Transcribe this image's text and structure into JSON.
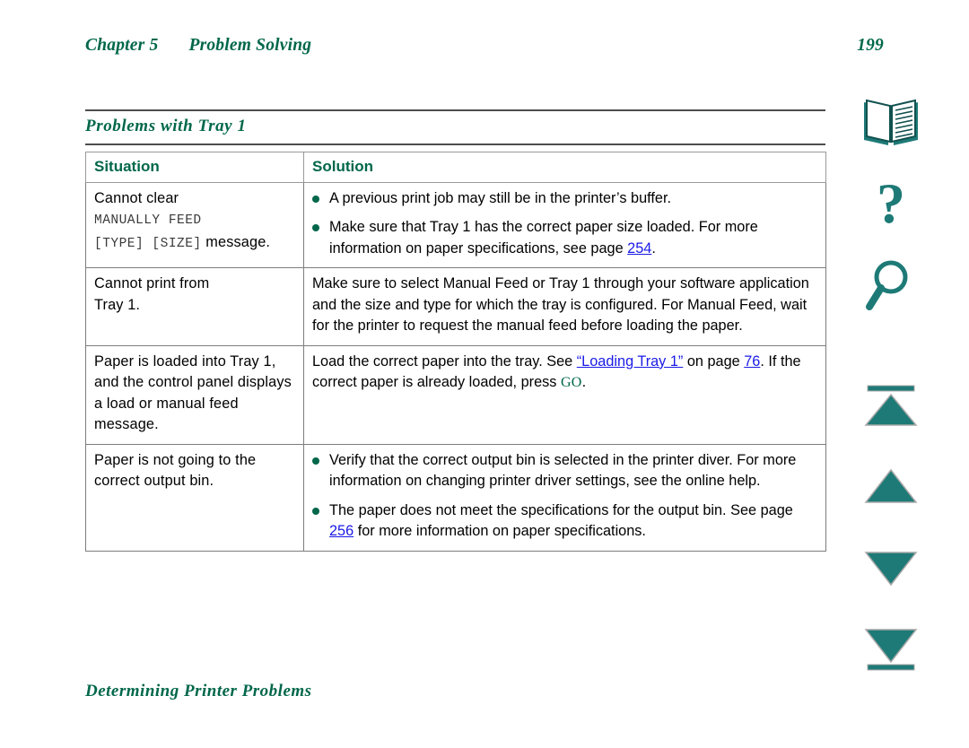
{
  "header": {
    "chapter": "Chapter 5",
    "chapter_title": "Problem Solving",
    "page_number": "199"
  },
  "section": {
    "title": "Problems with Tray 1"
  },
  "table": {
    "columns": [
      "Situation",
      "Solution"
    ],
    "rows": [
      {
        "situation_line1": "Cannot clear",
        "situation_mono1": "MANUALLY FEED",
        "situation_mono2": "[TYPE] [SIZE]",
        "situation_tail": " message.",
        "solution_bullets": [
          {
            "pre": "A previous print job may still be in the printer’s buffer.",
            "link": "",
            "post": ""
          },
          {
            "pre": "Make sure that Tray 1 has the correct paper size loaded. For more information on paper specifications, see page ",
            "link": "254",
            "post": "."
          }
        ]
      },
      {
        "situation_line1": "Cannot print from",
        "situation_line2": "Tray 1.",
        "solution_text": "Make sure to select Manual Feed or Tray 1 through your software application and the size and type for which the tray is configured. For Manual Feed, wait for the printer to request the manual feed before loading the paper."
      },
      {
        "situation_text": "Paper is loaded into Tray 1, and the control panel displays a load or manual feed message.",
        "solution_pre": "Load the correct paper into the tray. See ",
        "solution_link1": "“Loading Tray 1”",
        "solution_mid": " on page ",
        "solution_link2": "76",
        "solution_post": ". If the correct paper is already loaded, press ",
        "solution_key": "GO",
        "solution_end": "."
      },
      {
        "situation_text": "Paper is not going to the correct output bin.",
        "solution_bullets": [
          {
            "pre": "Verify that the correct output bin is selected in the printer diver. For more information on changing printer driver settings, see the online help.",
            "link": "",
            "post": ""
          },
          {
            "pre": "The paper does not meet the specifications for the output bin. See page ",
            "link": "256",
            "post": " for more information on paper specifications."
          }
        ]
      }
    ]
  },
  "footer": {
    "title": "Determining Printer Problems"
  },
  "nav_rail": {
    "items": [
      {
        "name": "contents-book-icon",
        "label": "Contents"
      },
      {
        "name": "help-question-icon",
        "label": "Index"
      },
      {
        "name": "search-magnifier-icon",
        "label": "Search"
      },
      {
        "name": "first-page-icon",
        "label": "First page"
      },
      {
        "name": "previous-page-icon",
        "label": "Previous page"
      },
      {
        "name": "next-page-icon",
        "label": "Next page"
      },
      {
        "name": "last-page-icon",
        "label": "Last page"
      }
    ]
  },
  "colors": {
    "brand_green": "#00674a",
    "link_blue": "#1a1ae6",
    "rule_gray": "#4d4d4d",
    "icon_teal": "#1e7a77"
  }
}
